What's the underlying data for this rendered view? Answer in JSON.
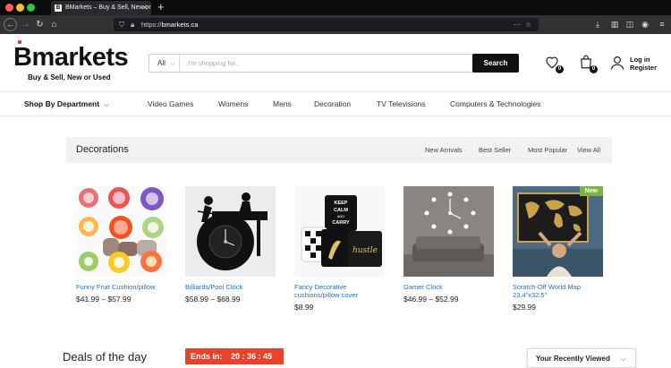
{
  "browser": {
    "tab_title": "BMarkets – Buy & Sell, New or",
    "tab_favicon": "B",
    "url_prefix": "https://",
    "url_host": "bmarkets.ca"
  },
  "header": {
    "logo_text": "Bmarkets",
    "logo_tagline": "Buy & Sell, New or Used",
    "search_category": "All",
    "search_placeholder": "I'm shopping for...",
    "search_button": "Search",
    "wishlist_count": "0",
    "cart_count": "0",
    "login_line1": "Log in",
    "login_line2": "Register"
  },
  "nav": {
    "department": "Shop By Department",
    "items": [
      "Video Games",
      "Womens",
      "Mens",
      "Decoration",
      "TV Televisions",
      "Computers & Technologies"
    ]
  },
  "section": {
    "title": "Decorations",
    "links": [
      "New Arrivals",
      "Best Seller",
      "Most Popular",
      "View All"
    ]
  },
  "products": [
    {
      "name": "Funny Fruit Cushion/pillow",
      "price": "$41.99 – $57.99"
    },
    {
      "name": "Billiards/Pool Clock",
      "price": "$58.99 – $68.99"
    },
    {
      "name": "Fancy Decorative cushions/pillow cover",
      "price": "$8.99"
    },
    {
      "name": "Gamer Clock",
      "price": "$46.99 – $52.99"
    },
    {
      "name": "Scratch-Off World Map 23.4\"x32.5\"",
      "price": "$29.99",
      "badge": "New"
    }
  ],
  "deals": {
    "title": "Deals of the day",
    "ends_label": "Ends in:",
    "timer": "20 : 36 : 45"
  },
  "recent": {
    "label": "Your Recently Viewed"
  },
  "image_text": {
    "keep_calm": [
      "KEEP",
      "CALM",
      "AND",
      "CARRY"
    ],
    "hustle": "hustle"
  },
  "colors": {
    "link_blue": "#1e6fc9",
    "deal_red": "#e8412c",
    "new_green": "#7cb342"
  }
}
